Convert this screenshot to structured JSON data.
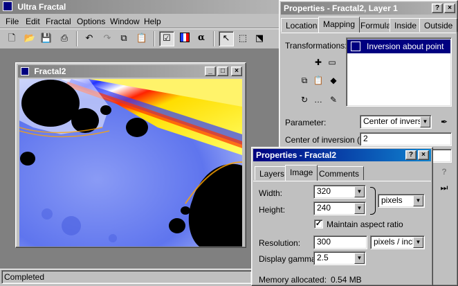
{
  "app": {
    "title": "Ultra Fractal",
    "menu": [
      "File",
      "Edit",
      "Fractal",
      "Options",
      "Window",
      "Help"
    ],
    "status": "Completed"
  },
  "fractal_window": {
    "title": "Fractal2"
  },
  "props_layer": {
    "title": "Properties - Fractal2, Layer 1",
    "tabs": [
      "Location",
      "Mapping",
      "Formula",
      "Inside",
      "Outside"
    ],
    "selected_tab": "Mapping",
    "transformations_label": "Transformations:",
    "transformations": [
      "Inversion about point"
    ],
    "parameter_label": "Parameter:",
    "parameter_value": "Center of inversio",
    "center_label": "Center of inversion (...",
    "center_value": "2"
  },
  "props_image": {
    "title": "Properties - Fractal2",
    "tabs": [
      "Layers",
      "Image",
      "Comments"
    ],
    "selected_tab": "Image",
    "width_label": "Width:",
    "width_value": "320",
    "height_label": "Height:",
    "height_value": "240",
    "unit_value": "pixels",
    "maintain_label": "Maintain aspect ratio",
    "maintain_checked": true,
    "resolution_label": "Resolution:",
    "resolution_value": "300",
    "resolution_unit": "pixels / inch",
    "gamma_label": "Display gamma:",
    "gamma_value": "2.5",
    "memory_label": "Memory allocated:",
    "memory_value": "0.54 MB"
  },
  "colors": {
    "title_active": "#000080",
    "face": "#c0c0c0",
    "desktop": "#808080",
    "selection": "#000080"
  }
}
